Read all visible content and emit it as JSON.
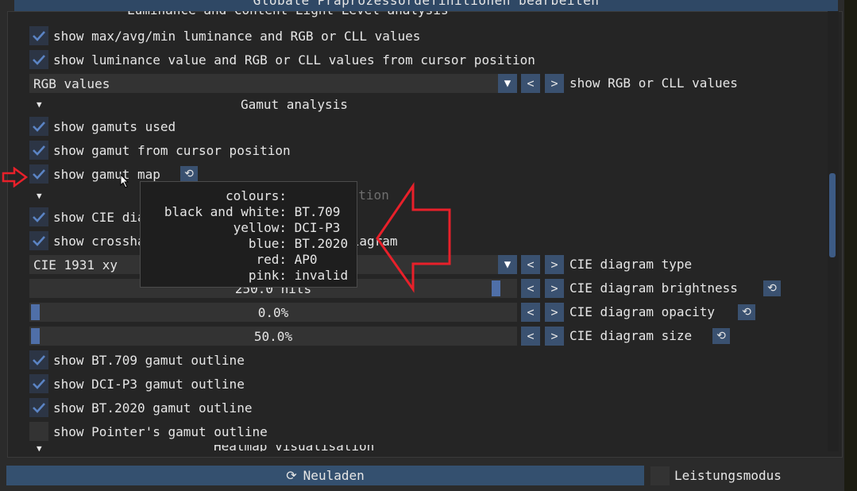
{
  "header": {
    "title": "Globale Präprozessordefinitionen bearbeiten"
  },
  "section_cut": {
    "label": "Luminance and Content Light Level analysis"
  },
  "luminance": {
    "show_maxavgmin": {
      "label": "show max/avg/min luminance and RGB or CLL values",
      "checked": true
    },
    "show_cursor": {
      "label": "show luminance value and RGB or CLL values from cursor position",
      "checked": true
    },
    "combo": {
      "value": "RGB values",
      "label": "show RGB or CLL values"
    }
  },
  "gamut": {
    "title": "Gamut analysis",
    "show_used": {
      "label": "show gamuts used",
      "checked": true
    },
    "show_cursor": {
      "label": "show gamut from cursor position",
      "checked": true
    },
    "show_map": {
      "label": "show gamut map",
      "checked": true
    }
  },
  "cie": {
    "title": "CIE diagram visualisation",
    "show_diagram": {
      "label": "show CIE diagram",
      "checked": true
    },
    "show_crosshair": {
      "label": "show crosshair of cursor gamut in CIE diagram",
      "checked": true
    },
    "type": {
      "value": "CIE 1931 xy",
      "label": "CIE diagram type"
    },
    "brightness": {
      "value": "250.0 nits",
      "label": "CIE diagram brightness",
      "fraction": 0.97
    },
    "opacity": {
      "value": "0.0%",
      "label": "CIE diagram opacity",
      "fraction": 0.0
    },
    "size": {
      "value": "50.0%",
      "label": "CIE diagram size",
      "fraction": 0.0
    },
    "outlines": [
      {
        "label": "show BT.709 gamut outline",
        "checked": true
      },
      {
        "label": "show DCI-P3 gamut outline",
        "checked": true
      },
      {
        "label": "show BT.2020 gamut outline",
        "checked": true
      },
      {
        "label": "show Pointer's gamut outline",
        "checked": false
      }
    ]
  },
  "heatmap": {
    "title": "Heatmap visualisation"
  },
  "tooltip": {
    "header": "colours:",
    "rows": [
      {
        "key": "black and white:",
        "value": "BT.709"
      },
      {
        "key": "yellow:",
        "value": "DCI-P3"
      },
      {
        "key": "blue:",
        "value": "BT.2020"
      },
      {
        "key": "red:",
        "value": "AP0"
      },
      {
        "key": "pink:",
        "value": "invalid"
      }
    ]
  },
  "footer": {
    "reload": {
      "label": "Neuladen",
      "icon": "reload-icon"
    },
    "performance": {
      "label": "Leistungsmodus",
      "checked": false
    }
  },
  "buttons": {
    "prev": "<",
    "next": ">"
  },
  "colors": {
    "accent": "#3a5170",
    "header": "#2f4865",
    "annotation": "#e8202a"
  }
}
